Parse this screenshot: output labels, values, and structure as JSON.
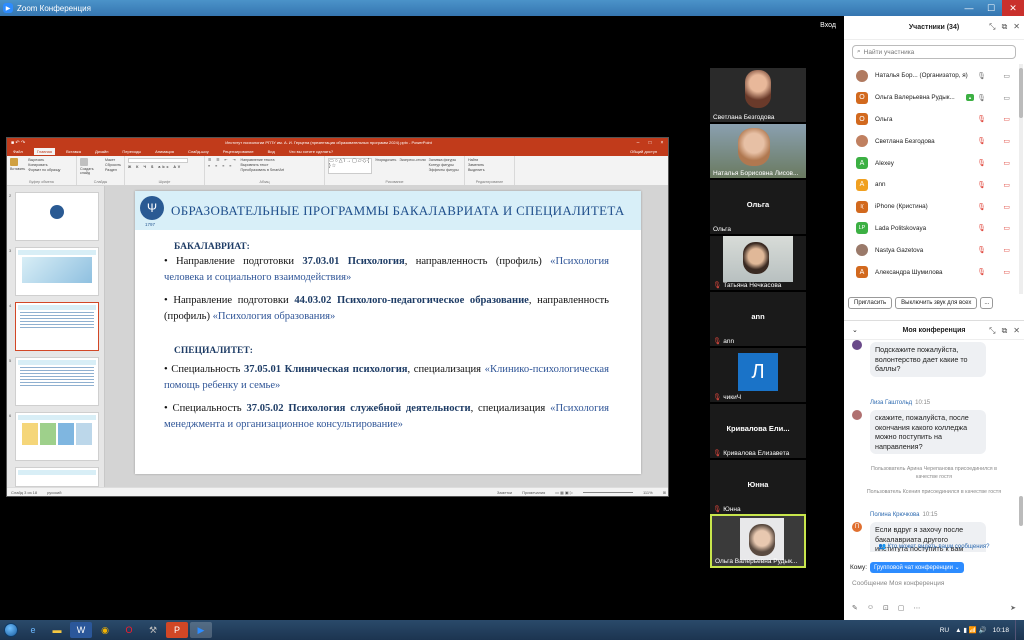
{
  "window": {
    "title": "Zoom Конференция",
    "exit_label": "Вход"
  },
  "ppt": {
    "title": "Институт психологии РГПУ им. А. И. Герцена (презентация образовательных программ 2024).pptx - PowerPoint",
    "account": "Общий доступ",
    "tabs": [
      "Файл",
      "Главная",
      "Вставка",
      "Дизайн",
      "Переходы",
      "Анимация",
      "Слайд-шоу",
      "Рецензирование",
      "Вид",
      "Что вы хотите сделать?"
    ],
    "ribbon_groups": [
      "Буфер обмена",
      "Слайды",
      "Шрифт",
      "Абзац",
      "Рисование",
      "Редактирование"
    ],
    "ribbon_items": [
      "Вырезать",
      "Копировать",
      "Формат по образцу",
      "Вставить",
      "Макет",
      "Сбросить",
      "Раздел",
      "Создать слайд",
      "Направление текста",
      "Выровнять текст",
      "Преобразовать в SmartArt",
      "Упорядочить",
      "Экспресс-стили",
      "Заливка фигуры",
      "Контур фигуры",
      "Эффекты фигуры",
      "Найти",
      "Заменить",
      "Выделить"
    ],
    "status": {
      "slide": "Слайд 3 из 18",
      "lang": "русский",
      "notes": "Заметки",
      "comments": "Примечания",
      "zoom": "111%"
    },
    "thumbs": [
      {
        "num": "2",
        "selected": false
      },
      {
        "num": "3",
        "selected": true
      },
      {
        "num": "4",
        "selected": false
      },
      {
        "num": "5",
        "selected": false
      },
      {
        "num": "6",
        "selected": false
      }
    ],
    "slide": {
      "year": "1797",
      "title": "ОБРАЗОВАТЕЛЬНЫЕ ПРОГРАММЫ БАКАЛАВРИАТА И СПЕЦИАЛИТЕТА",
      "sec1": "БАКАЛАВРИАТ:",
      "b1_pre": "• Направление подготовки ",
      "b1_code": "37.03.01",
      "b1_name": "Психология",
      "b1_mid": ", направленность (профиль) ",
      "b1_prof": "«Психология человека и социального взаимодействия»",
      "b2_pre": "• Направление подготовки ",
      "b2_code": "44.03.02",
      "b2_name": "Психолого-педагогическое образование",
      "b2_mid": ", направленность (профиль) ",
      "b2_prof": "«Психология образования»",
      "sec2": "СПЕЦИАЛИТЕТ:",
      "s1_pre": "• Специальность ",
      "s1_code": "37.05.01",
      "s1_name": "Клиническая психология",
      "s1_mid": ", специализация ",
      "s1_prof": "«Клинико-психологическая помощь ребенку и семье»",
      "s2_pre": "• Специальность ",
      "s2_code": "37.05.02",
      "s2_name": "Психология служебной деятельности",
      "s2_mid": ", специализация ",
      "s2_prof": "«Психология менеджмента и организационное консультирование»"
    }
  },
  "videos": [
    {
      "name": "Светлана Безгодова",
      "center": "",
      "muted": false
    },
    {
      "name": "Наталья Борисовна Лисов...",
      "center": "",
      "muted": false
    },
    {
      "name": "Ольга",
      "center": "Ольга",
      "muted": false
    },
    {
      "name": "Татьяна Нечкасова",
      "center": "",
      "muted": true
    },
    {
      "name": "ann",
      "center": "ann",
      "muted": true
    },
    {
      "name": "чикиЧ",
      "center": "Л",
      "muted": true
    },
    {
      "name": "Кривалова Елизавета",
      "center": "Кривалова Ели...",
      "muted": true
    },
    {
      "name": "Юнна",
      "center": "Юнна",
      "muted": true
    },
    {
      "name": "Ольга Валерьевна Рудык...",
      "center": "",
      "muted": false
    }
  ],
  "participants": {
    "title": "Участники (34)",
    "search_placeholder": "Найти участника",
    "list": [
      {
        "name": "Наталья Бор... (Организатор, я)",
        "avatar": "",
        "color": "#b07a60",
        "mic": "on",
        "cam": "on"
      },
      {
        "name": "Ольга Валерьевна Рудык...",
        "avatar": "О",
        "color": "#d2691e",
        "mic": "on",
        "cam": "on"
      },
      {
        "name": "Ольга",
        "avatar": "О",
        "color": "#d2691e",
        "mic": "off",
        "cam": "off"
      },
      {
        "name": "Светлана Безгодова",
        "avatar": "",
        "color": "#c08060",
        "mic": "off",
        "cam": "off"
      },
      {
        "name": "Alexey",
        "avatar": "A",
        "color": "#3cb043",
        "mic": "off",
        "cam": "off"
      },
      {
        "name": "ann",
        "avatar": "A",
        "color": "#f0a020",
        "mic": "off",
        "cam": "off"
      },
      {
        "name": "iPhone (Кристина)",
        "avatar": "I(",
        "color": "#d2691e",
        "mic": "off",
        "cam": "off"
      },
      {
        "name": "Lada Politskovaya",
        "avatar": "LP",
        "color": "#3cb043",
        "mic": "off",
        "cam": "off"
      },
      {
        "name": "Nastya Gazetova",
        "avatar": "",
        "color": "#9a7a6a",
        "mic": "off",
        "cam": "off"
      },
      {
        "name": "Александра Шумилова",
        "avatar": "А",
        "color": "#d2691e",
        "mic": "off",
        "cam": "off"
      }
    ],
    "invite_label": "Пригласить",
    "mute_all_label": "Выключить звук для всех",
    "more_label": "..."
  },
  "chat": {
    "title": "Моя конференция",
    "messages": [
      {
        "sender": "",
        "time": "",
        "text": "Подскажите пожалуйста, волонтерство дает какие то баллы?"
      },
      {
        "sender": "Лиза Гаштольд",
        "time": "10:15",
        "text": "скажите, пожалуйста, после окончания какого колледжа можно поступить на направления?"
      },
      {
        "sender": "Полина Крючкова",
        "time": "10:15",
        "text": "Если вдруг я захочу после бакалавриата другого института поступить к вам"
      }
    ],
    "system": [
      "Пользователь Арина Черепанова присоединился в качестве гостя",
      "Пользователь Ксения присоединился в качестве гостя"
    ],
    "who_can_see": "Кто может видеть ваши сообщения?",
    "to_label": "Кому:",
    "to_value": "Групповой чат конференции",
    "input_placeholder": "Сообщение Моя конференция"
  },
  "taskbar": {
    "lang": "RU",
    "time": "10:18"
  }
}
